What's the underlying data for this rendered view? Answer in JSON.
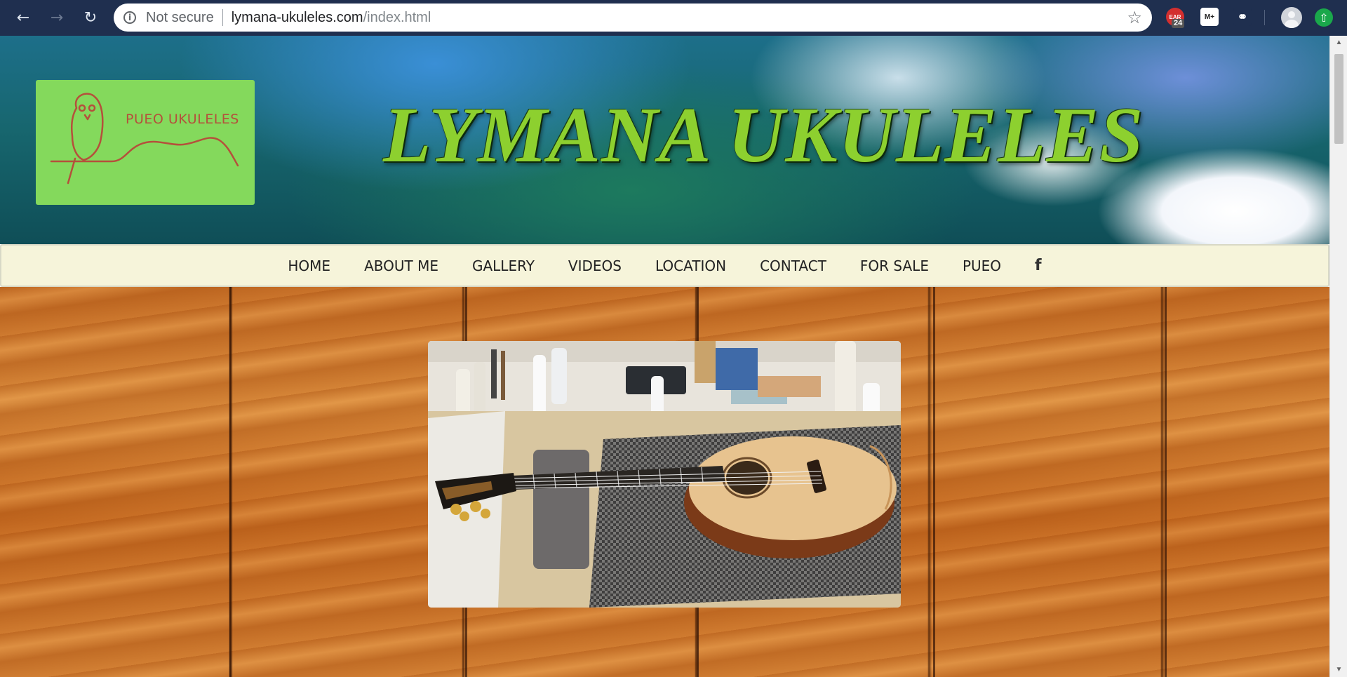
{
  "browser": {
    "security_label": "Not secure",
    "url_host": "lymana-ukuleles.com",
    "url_path": "/index.html",
    "extension_badge": "24"
  },
  "header": {
    "logo_text": "PUEO UKULELES",
    "site_title": "LYMANA UKULELES"
  },
  "nav": {
    "items": [
      "HOME",
      "ABOUT ME",
      "GALLERY",
      "VIDEOS",
      "LOCATION",
      "CONTACT",
      "FOR SALE",
      "PUEO"
    ],
    "facebook_glyph": "f"
  },
  "colors": {
    "browser_bar": "#1f2f4f",
    "logo_bg": "#84d95c",
    "logo_ink": "#b5503b",
    "title_green": "#8dd02f",
    "nav_bg": "#f6f4da"
  }
}
